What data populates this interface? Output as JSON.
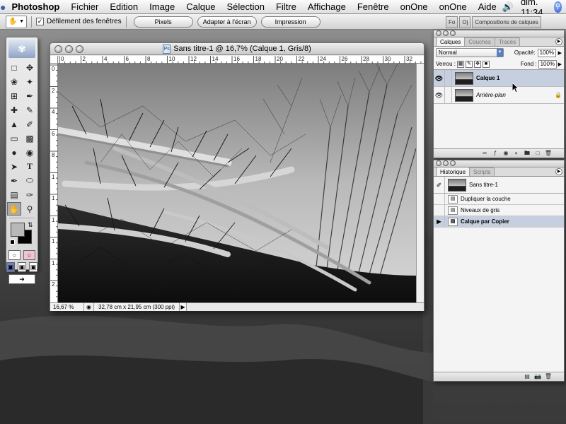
{
  "menubar": {
    "apple_icon": "apple-logo",
    "app_name": "Photoshop",
    "items": [
      "Fichier",
      "Edition",
      "Image",
      "Calque",
      "Sélection",
      "Filtre",
      "Affichage",
      "Fenêtre",
      "onOne",
      "onOne",
      "Aide"
    ],
    "clock": "dim. 11:34",
    "volume_icon": "volume-icon",
    "spotlight_icon": "spotlight-icon"
  },
  "options": {
    "tool_icon": "hand-icon",
    "checkbox_label": "Défilement des fenêtres",
    "checkbox_checked": true,
    "buttons": [
      "Pixels",
      "Adapter à l'écran",
      "Impression"
    ],
    "well_tabs": [
      "Fo",
      "Oj",
      "Compositions de calques"
    ]
  },
  "document": {
    "title": "Sans titre-1 @ 16,7% (Calque 1, Gris/8)",
    "ruler_top": [
      "0",
      "2",
      "4",
      "6",
      "8",
      "10",
      "12",
      "14",
      "16",
      "18",
      "20",
      "22",
      "24",
      "26",
      "28",
      "30",
      "32"
    ],
    "ruler_left": [
      "0",
      "2",
      "4",
      "6",
      "8",
      "1",
      "1",
      "1",
      "1",
      "1",
      "2"
    ],
    "zoom": "16,67 %",
    "size_info": "32,78 cm x 21,95 cm (300 ppi)"
  },
  "layers_palette": {
    "tabs": [
      "Calques",
      "Couches",
      "Tracés"
    ],
    "active_tab": "Calques",
    "blend_mode": "Normal",
    "opacity_label": "Opacité:",
    "opacity": "100%",
    "lock_label": "Verrou :",
    "fill_label": "Fond :",
    "fill": "100%",
    "layers": [
      {
        "name": "Calque 1",
        "selected": true,
        "visible": true,
        "locked": false
      },
      {
        "name": "Arrière-plan",
        "selected": false,
        "visible": true,
        "locked": true
      }
    ]
  },
  "history_palette": {
    "tabs": [
      "Historique",
      "Scripts"
    ],
    "active_tab": "Historique",
    "snapshot": "Sans titre-1",
    "steps": [
      {
        "label": "Dupliquer la couche",
        "current": false
      },
      {
        "label": "Niveaux de gris",
        "current": false
      },
      {
        "label": "Calque par Copier",
        "current": true
      }
    ]
  },
  "colors": {
    "selection": "#c6cfe0",
    "foreground_swatch": "#b8b8b8",
    "background_swatch": "#000000"
  }
}
